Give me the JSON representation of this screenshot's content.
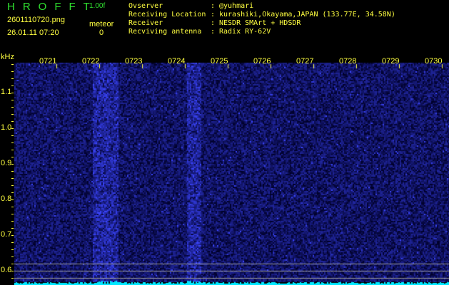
{
  "header": {
    "logo": "HROFFT",
    "version": "1.00f",
    "filename": "2601110720.png",
    "datetime": "26.01.11 07:20",
    "meteor_label": "meteor",
    "meteor_count": "0"
  },
  "info": [
    {
      "label": "Ovserver",
      "value": "@yuhmari"
    },
    {
      "label": "Receiving Location",
      "value": "kurashiki,Okayama,JAPAN (133.77E, 34.58N)"
    },
    {
      "label": "Receiver",
      "value": "NESDR SMArt + HDSDR"
    },
    {
      "label": "Recviving antenna",
      "value": "Radix RY-62V"
    }
  ],
  "axis": {
    "unit": "kHz",
    "time_ticks": [
      "0721",
      "0722",
      "0723",
      "0724",
      "0725",
      "0726",
      "0727",
      "0728",
      "0729",
      "0730"
    ],
    "freq_ticks": [
      "1.1",
      "1.0",
      "0.9",
      "0.8",
      "0.7",
      "0.6"
    ]
  },
  "colors": {
    "text": "#ffff40",
    "logo": "#30e030",
    "signal": "#2030ff",
    "baseline": "#00e8ff"
  }
}
